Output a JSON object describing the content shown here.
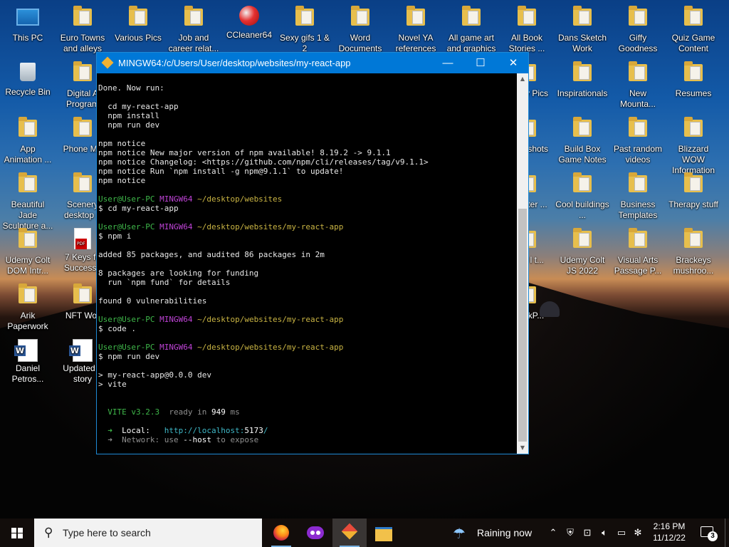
{
  "desktop_icons": [
    {
      "id": "this-pc",
      "label": "This PC",
      "type": "pc"
    },
    {
      "id": "euro-towns",
      "label": "Euro Towns and alleys",
      "type": "folder"
    },
    {
      "id": "various-pics",
      "label": "Various Pics",
      "type": "folder"
    },
    {
      "id": "job-career",
      "label": "Job and career relat...",
      "type": "folder"
    },
    {
      "id": "ccleaner",
      "label": "CCleaner64",
      "type": "ccleaner"
    },
    {
      "id": "sexy-gifs",
      "label": "Sexy gifs 1 & 2",
      "type": "folder"
    },
    {
      "id": "word-docs",
      "label": "Word Documents",
      "type": "folder"
    },
    {
      "id": "novel-ya",
      "label": "Novel YA references",
      "type": "folder"
    },
    {
      "id": "game-art",
      "label": "All game art and graphics",
      "type": "folder"
    },
    {
      "id": "book-stories",
      "label": "All Book Stories ...",
      "type": "folder"
    },
    {
      "id": "dans-sketch",
      "label": "Dans Sketch Work",
      "type": "folder"
    },
    {
      "id": "giffy",
      "label": "Giffy Goodness",
      "type": "folder"
    },
    {
      "id": "quiz-game",
      "label": "Quiz Game Content",
      "type": "folder"
    },
    {
      "id": "recycle-bin",
      "label": "Recycle Bin",
      "type": "bin"
    },
    {
      "id": "digital-a",
      "label": "Digital A Program",
      "type": "folder"
    },
    {
      "id": "op-pics",
      "label": "op & y Pics",
      "type": "folder"
    },
    {
      "id": "inspirationals",
      "label": "Inspirationals",
      "type": "folder"
    },
    {
      "id": "new-mounta",
      "label": "New Mounta...",
      "type": "folder"
    },
    {
      "id": "resumes",
      "label": "Resumes",
      "type": "folder"
    },
    {
      "id": "app-animation",
      "label": "App Animation ...",
      "type": "folder"
    },
    {
      "id": "phone-me",
      "label": "Phone Me",
      "type": "folder"
    },
    {
      "id": "drive-shots",
      "label": "Drive shots",
      "type": "folder"
    },
    {
      "id": "build-box",
      "label": "Build Box Game Notes",
      "type": "folder"
    },
    {
      "id": "past-random",
      "label": "Past random videos",
      "type": "folder"
    },
    {
      "id": "blizzard",
      "label": "Blizzard WOW Information",
      "type": "folder"
    },
    {
      "id": "beautiful-jade",
      "label": "Beautiful Jade Sculpture a...",
      "type": "folder"
    },
    {
      "id": "scenery",
      "label": "Scenery desktop p",
      "type": "folder"
    },
    {
      "id": "2020",
      "label": "2020 ter ...",
      "type": "folder"
    },
    {
      "id": "cool-buildings",
      "label": "Cool buildings ...",
      "type": "folder"
    },
    {
      "id": "business-templates",
      "label": "Business Templates",
      "type": "folder"
    },
    {
      "id": "therapy",
      "label": "Therapy stuff",
      "type": "folder"
    },
    {
      "id": "udemy-dom",
      "label": "Udemy Colt DOM Intr...",
      "type": "folder"
    },
    {
      "id": "7-keys",
      "label": "7 Keys fo Success f",
      "type": "pdf"
    },
    {
      "id": "ness",
      "label": "ness l t...",
      "type": "folder"
    },
    {
      "id": "udemy-js",
      "label": "Udemy Colt JS 2022",
      "type": "folder"
    },
    {
      "id": "visual-arts",
      "label": "Visual Arts Passage P...",
      "type": "folder"
    },
    {
      "id": "brackeys",
      "label": "Brackeys mushroo...",
      "type": "folder"
    },
    {
      "id": "arik",
      "label": "Arik Paperwork",
      "type": "folder"
    },
    {
      "id": "nft-wor",
      "label": "NFT Wor",
      "type": "folder"
    },
    {
      "id": "st-bookp",
      "label": "st ookP...",
      "type": "folder"
    },
    {
      "id": "daniel",
      "label": "Daniel Petros...",
      "type": "word"
    },
    {
      "id": "updated-story",
      "label": "Updated a story",
      "type": "word"
    }
  ],
  "terminal": {
    "title": "MINGW64:/c/Users/User/desktop/websites/my-react-app",
    "buttons": {
      "minimize": "—",
      "maximize": "☐",
      "close": "✕"
    },
    "lines": [
      [
        {
          "t": "Done. Now run:"
        }
      ],
      [
        {
          "t": ""
        }
      ],
      [
        {
          "t": "  cd my-react-app"
        }
      ],
      [
        {
          "t": "  npm install"
        }
      ],
      [
        {
          "t": "  npm run dev"
        }
      ],
      [
        {
          "t": ""
        }
      ],
      [
        {
          "t": "npm notice"
        }
      ],
      [
        {
          "t": "npm notice New major version of npm available! 8.19.2 -> 9.1.1"
        }
      ],
      [
        {
          "t": "npm notice Changelog: <https://github.com/npm/cli/releases/tag/v9.1.1>"
        }
      ],
      [
        {
          "t": "npm notice Run `npm install -g npm@9.1.1` to update!"
        }
      ],
      [
        {
          "t": "npm notice"
        }
      ],
      [
        {
          "t": ""
        }
      ],
      [
        {
          "t": "User@User-PC",
          "c": "green"
        },
        {
          "t": " "
        },
        {
          "t": "MINGW64",
          "c": "magenta"
        },
        {
          "t": " "
        },
        {
          "t": "~/desktop/websites",
          "c": "yellow"
        }
      ],
      [
        {
          "t": "$ cd my-react-app"
        }
      ],
      [
        {
          "t": ""
        }
      ],
      [
        {
          "t": "User@User-PC",
          "c": "green"
        },
        {
          "t": " "
        },
        {
          "t": "MINGW64",
          "c": "magenta"
        },
        {
          "t": " "
        },
        {
          "t": "~/desktop/websites/my-react-app",
          "c": "yellow"
        }
      ],
      [
        {
          "t": "$ npm i"
        }
      ],
      [
        {
          "t": ""
        }
      ],
      [
        {
          "t": "added 85 packages, and audited 86 packages in 2m"
        }
      ],
      [
        {
          "t": ""
        }
      ],
      [
        {
          "t": "8 packages are looking for funding"
        }
      ],
      [
        {
          "t": "  run `npm fund` for details"
        }
      ],
      [
        {
          "t": ""
        }
      ],
      [
        {
          "t": "found 0 vulnerabilities"
        }
      ],
      [
        {
          "t": ""
        }
      ],
      [
        {
          "t": "User@User-PC",
          "c": "green"
        },
        {
          "t": " "
        },
        {
          "t": "MINGW64",
          "c": "magenta"
        },
        {
          "t": " "
        },
        {
          "t": "~/desktop/websites/my-react-app",
          "c": "yellow"
        }
      ],
      [
        {
          "t": "$ code ."
        }
      ],
      [
        {
          "t": ""
        }
      ],
      [
        {
          "t": "User@User-PC",
          "c": "green"
        },
        {
          "t": " "
        },
        {
          "t": "MINGW64",
          "c": "magenta"
        },
        {
          "t": " "
        },
        {
          "t": "~/desktop/websites/my-react-app",
          "c": "yellow"
        }
      ],
      [
        {
          "t": "$ npm run dev"
        }
      ],
      [
        {
          "t": ""
        }
      ],
      [
        {
          "t": "> my-react-app@0.0.0 dev"
        }
      ],
      [
        {
          "t": "> vite"
        }
      ],
      [
        {
          "t": ""
        }
      ],
      [
        {
          "t": ""
        }
      ],
      [
        {
          "t": "  "
        },
        {
          "t": "VITE v3.2.3",
          "c": "green"
        },
        {
          "t": "  "
        },
        {
          "t": "ready in",
          "c": "gray"
        },
        {
          "t": " "
        },
        {
          "t": "949",
          "c": "bright"
        },
        {
          "t": " "
        },
        {
          "t": "ms",
          "c": "gray"
        }
      ],
      [
        {
          "t": ""
        }
      ],
      [
        {
          "t": "  "
        },
        {
          "t": "➜",
          "c": "green"
        },
        {
          "t": "  "
        },
        {
          "t": "Local:",
          "c": "bright"
        },
        {
          "t": "   "
        },
        {
          "t": "http://localhost:",
          "c": "cyan"
        },
        {
          "t": "5173",
          "c": "bright"
        },
        {
          "t": "/",
          "c": "cyan"
        }
      ],
      [
        {
          "t": "  "
        },
        {
          "t": "➜",
          "c": "gray"
        },
        {
          "t": "  "
        },
        {
          "t": "Network: use",
          "c": "gray"
        },
        {
          "t": " "
        },
        {
          "t": "--host",
          "c": "bright"
        },
        {
          "t": " "
        },
        {
          "t": "to expose",
          "c": "gray"
        }
      ]
    ]
  },
  "taskbar": {
    "search_placeholder": "Type here to search",
    "apps": [
      {
        "name": "firefox",
        "open": true,
        "active": false
      },
      {
        "name": "mask-app",
        "open": false,
        "active": false
      },
      {
        "name": "git-bash",
        "open": true,
        "active": true
      },
      {
        "name": "file-explorer",
        "open": false,
        "active": false
      }
    ],
    "weather": "Raining now",
    "tray_icons": [
      "chevron-up-icon",
      "security-icon",
      "network-icon",
      "volume-icon",
      "display-icon",
      "bluetooth-icon"
    ],
    "time": "2:16 PM",
    "date": "11/12/22",
    "notifications": "3"
  }
}
